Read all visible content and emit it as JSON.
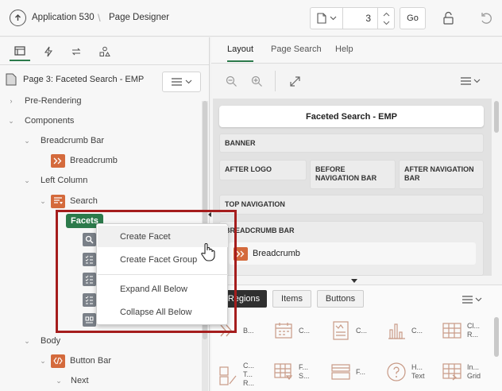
{
  "header": {
    "app_title": "Application 530",
    "separator": "\\",
    "page_title": "Page Designer",
    "page_number": "3",
    "go_label": "Go"
  },
  "left_tabs": [
    "rendering-icon",
    "dynamic-actions-icon",
    "processing-icon",
    "shared-components-icon"
  ],
  "page_node": {
    "label": "Page 3: Faceted Search - EMP"
  },
  "tree": {
    "pre_rendering": "Pre-Rendering",
    "components": "Components",
    "breadcrumb_bar": "Breadcrumb Bar",
    "breadcrumb": "Breadcrumb",
    "left_column": "Left Column",
    "search": "Search",
    "facets": "Facets",
    "body": "Body",
    "button_bar": "Button Bar",
    "next": "Next"
  },
  "context_menu": {
    "items": [
      "Create Facet",
      "Create Facet Group",
      "Expand All Below",
      "Collapse All Below"
    ]
  },
  "right_tabs": {
    "layout": "Layout",
    "page_search": "Page Search",
    "help": "Help"
  },
  "layout": {
    "page_title_region": "Faceted Search - EMP",
    "banner": "BANNER",
    "after_logo": "AFTER LOGO",
    "before_navigation_bar": "BEFORE NAVIGATION BAR",
    "after_navigation_bar": "AFTER NAVIGATION BAR",
    "top_navigation": "TOP NAVIGATION",
    "breadcrumb_bar": "BREADCRUMB BAR",
    "breadcrumb_component": "Breadcrumb"
  },
  "gallery": {
    "tabs": {
      "regions": "Regions",
      "items": "Items",
      "buttons": "Buttons"
    },
    "row1": [
      {
        "label": "B..."
      },
      {
        "label": "C..."
      },
      {
        "label": "C..."
      },
      {
        "label": "C..."
      },
      {
        "label": "Cl... R..."
      }
    ],
    "row2": [
      {
        "label": "C... T... R..."
      },
      {
        "label": "F... S..."
      },
      {
        "label": "F..."
      },
      {
        "label": "H... Text"
      },
      {
        "label": "In... Grid"
      }
    ]
  },
  "colors": {
    "accent": "#2c7a4b",
    "highlight": "#a51d1d",
    "brand_orange": "#d46a3c"
  }
}
